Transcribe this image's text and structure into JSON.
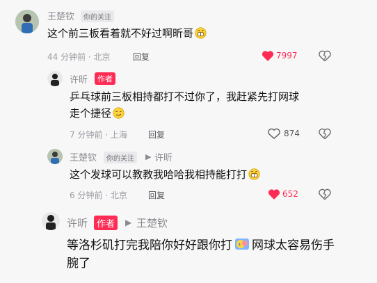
{
  "comments": [
    {
      "name": "王楚钦",
      "tag": "你的关注",
      "text": "这个前三板看着就不好过啊昕哥",
      "time_location": "44 分钟前 · 北京",
      "reply_label": "回复",
      "likes": "7997",
      "liked": true
    },
    {
      "name": "许昕",
      "author_badge": "作者",
      "text_line1": "乒乓球前三板相持都打不过你了，我赶紧先打网球",
      "text_line2": "走个捷径",
      "time_location": "7 分钟前 · 上海",
      "reply_label": "回复",
      "likes": "874",
      "liked": false
    },
    {
      "name": "王楚钦",
      "tag": "你的关注",
      "reply_to": "许昕",
      "text": "这个发球可以教教我哈哈我相持能打打",
      "time_location": "6 分钟前 · 北京",
      "reply_label": "回复",
      "likes": "652",
      "liked": true
    },
    {
      "name": "许昕",
      "author_badge": "作者",
      "reply_to": "王楚钦",
      "text_line1_a": "等洛杉矶打完我陪你好好跟你打",
      "text_line1_b": "网球太容易伤手",
      "text_line2": "腕了"
    }
  ],
  "colors": {
    "like_red": "#fe2c55",
    "meta_gray": "#9a9aa0",
    "text": "#111111"
  }
}
